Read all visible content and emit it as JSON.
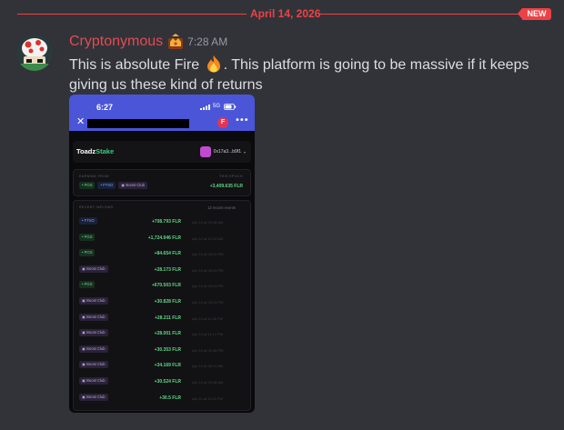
{
  "divider": {
    "date": "April 14, 2026",
    "badge": "NEW"
  },
  "colors": {
    "mention_red": "#ed4245",
    "username": "#e24b52",
    "accent_green": "#34d07a",
    "phone_header": "#4b55d8"
  },
  "message": {
    "username": "Cryptonymous",
    "role_icon": "crown-icon",
    "timestamp": "7:28 AM",
    "text_before": "This is absolute Fire",
    "emoji": "fire-emoji",
    "text_after": ". This platform is going to be massive if it keeps giving us these kind of returns"
  },
  "screenshot": {
    "status_time": "6:27",
    "network": "5G",
    "app_name_prefix": "Toadz",
    "app_name_suffix": "Stake",
    "wallet_address": "0x17a3...b9f1",
    "earning_label": "EARNING FROM",
    "epoch_label": "THIS EPOCH",
    "earning_chips": [
      {
        "label": "POS",
        "kind": "pos"
      },
      {
        "label": "FTSO",
        "kind": "ftso"
      },
      {
        "label": "Boost Club",
        "kind": "boost"
      }
    ],
    "epoch_total": "+3,409.635 FLR",
    "inflows_label": "RECENT INFLOWS",
    "inflows_count": "12 recent events",
    "inflows": [
      {
        "source": "FTSO",
        "kind": "ftso",
        "amount": "+708.793 FLR",
        "date": "Apr 14 at 03:08 AM"
      },
      {
        "source": "PGS",
        "kind": "pos",
        "amount": "+1,724.946 FLR",
        "date": "Apr 14 at 12:12 AM"
      },
      {
        "source": "POS",
        "kind": "pos",
        "amount": "+84.654 FLR",
        "date": "Apr 13 at 09:12 PM"
      },
      {
        "source": "Boost Club",
        "kind": "boost",
        "amount": "+28.173 FLR",
        "date": "Apr 13 at 05:09 PM"
      },
      {
        "source": "PGS",
        "kind": "pos",
        "amount": "+670.503 FLR",
        "date": "Apr 13 at 05:03 PM"
      },
      {
        "source": "Boost Club",
        "kind": "boost",
        "amount": "+30.828 FLR",
        "date": "Apr 13 at 03:13 PM"
      },
      {
        "source": "Boost Club",
        "kind": "boost",
        "amount": "+28.211 FLR",
        "date": "Apr 13 at 11:06 PM"
      },
      {
        "source": "Boost Club",
        "kind": "boost",
        "amount": "+28.001 FLR",
        "date": "Apr 13 at 11:17 PM"
      },
      {
        "source": "Boost Club",
        "kind": "boost",
        "amount": "+30.353 FLR",
        "date": "Apr 13 at 01:08 PM"
      },
      {
        "source": "Boost Club",
        "kind": "boost",
        "amount": "+34.169 FLR",
        "date": "Apr 12 at 06:17 AM"
      },
      {
        "source": "Boost Club",
        "kind": "boost",
        "amount": "+30.524 FLR",
        "date": "Apr 12 at 03:08 AM"
      },
      {
        "source": "Boost Club",
        "kind": "boost",
        "amount": "+30.5 FLR",
        "date": "Apr 11 at 11:29 PM"
      }
    ]
  }
}
